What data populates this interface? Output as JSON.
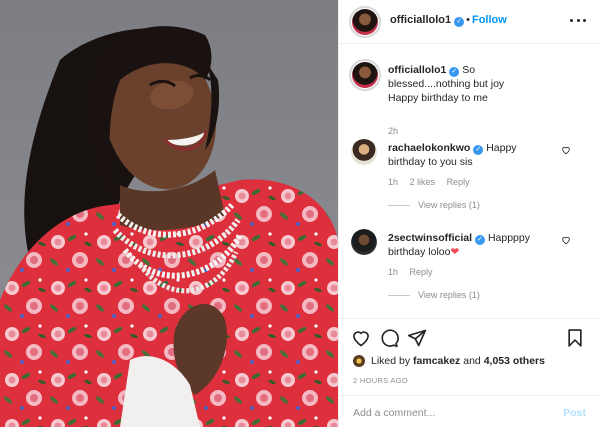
{
  "header": {
    "username": "officiallolo1",
    "separator": "•",
    "follow_label": "Follow"
  },
  "caption": {
    "username": "officiallolo1",
    "text": "So blessed....nothing but joy",
    "text2": "Happy birthday to me",
    "time": "2h"
  },
  "comments": [
    {
      "username": "rachaelokonkwo",
      "text": "Happy birthday to you sis",
      "time": "1h",
      "likes": "2 likes",
      "reply_label": "Reply",
      "view_replies": "View replies (1)"
    },
    {
      "username": "2sectwinsofficial",
      "text": "Happppy birthday loloo",
      "emoji": "❤",
      "time": "1h",
      "reply_label": "Reply",
      "view_replies": "View replies (1)"
    }
  ],
  "likes": {
    "prefix": "Liked by",
    "by_user": "famcakez",
    "and": "and",
    "others": "4,053 others"
  },
  "timestamp": "2 HOURS AGO",
  "add_comment": {
    "placeholder": "Add a comment...",
    "post_label": "Post"
  },
  "icons": {
    "verified": "verified-badge-icon",
    "more": "more-options-icon",
    "like": "heart-icon",
    "comment": "comment-bubble-icon",
    "share": "paper-plane-icon",
    "save": "bookmark-icon"
  },
  "colors": {
    "accent_blue": "#0095f6",
    "verified_blue": "#3897f0",
    "muted_text": "#8e8e8e",
    "post_disabled": "#b2dffc",
    "dress_red": "#e0303f",
    "heart_red": "#ed4956"
  }
}
